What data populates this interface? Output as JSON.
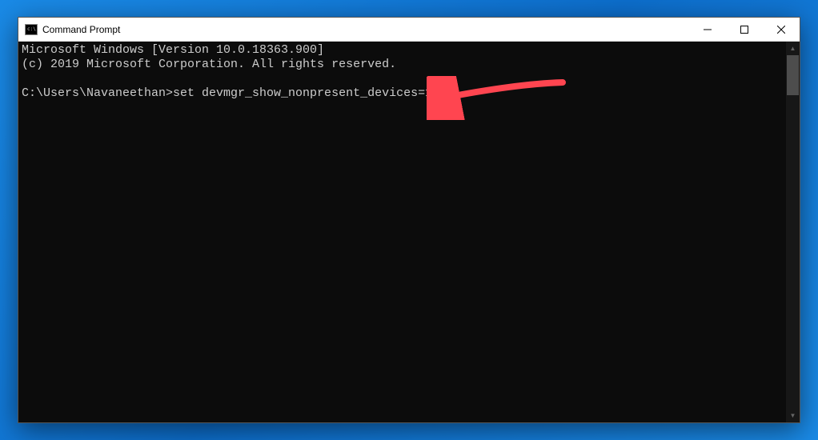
{
  "window": {
    "title": "Command Prompt"
  },
  "terminal": {
    "line1": "Microsoft Windows [Version 10.0.18363.900]",
    "line2": "(c) 2019 Microsoft Corporation. All rights reserved.",
    "blank": "",
    "prompt": "C:\\Users\\Navaneethan>",
    "command": "set devmgr_show_nonpresent_devices=1"
  },
  "annotation": {
    "color": "#ff4550",
    "description": "arrow-pointing-to-command"
  }
}
